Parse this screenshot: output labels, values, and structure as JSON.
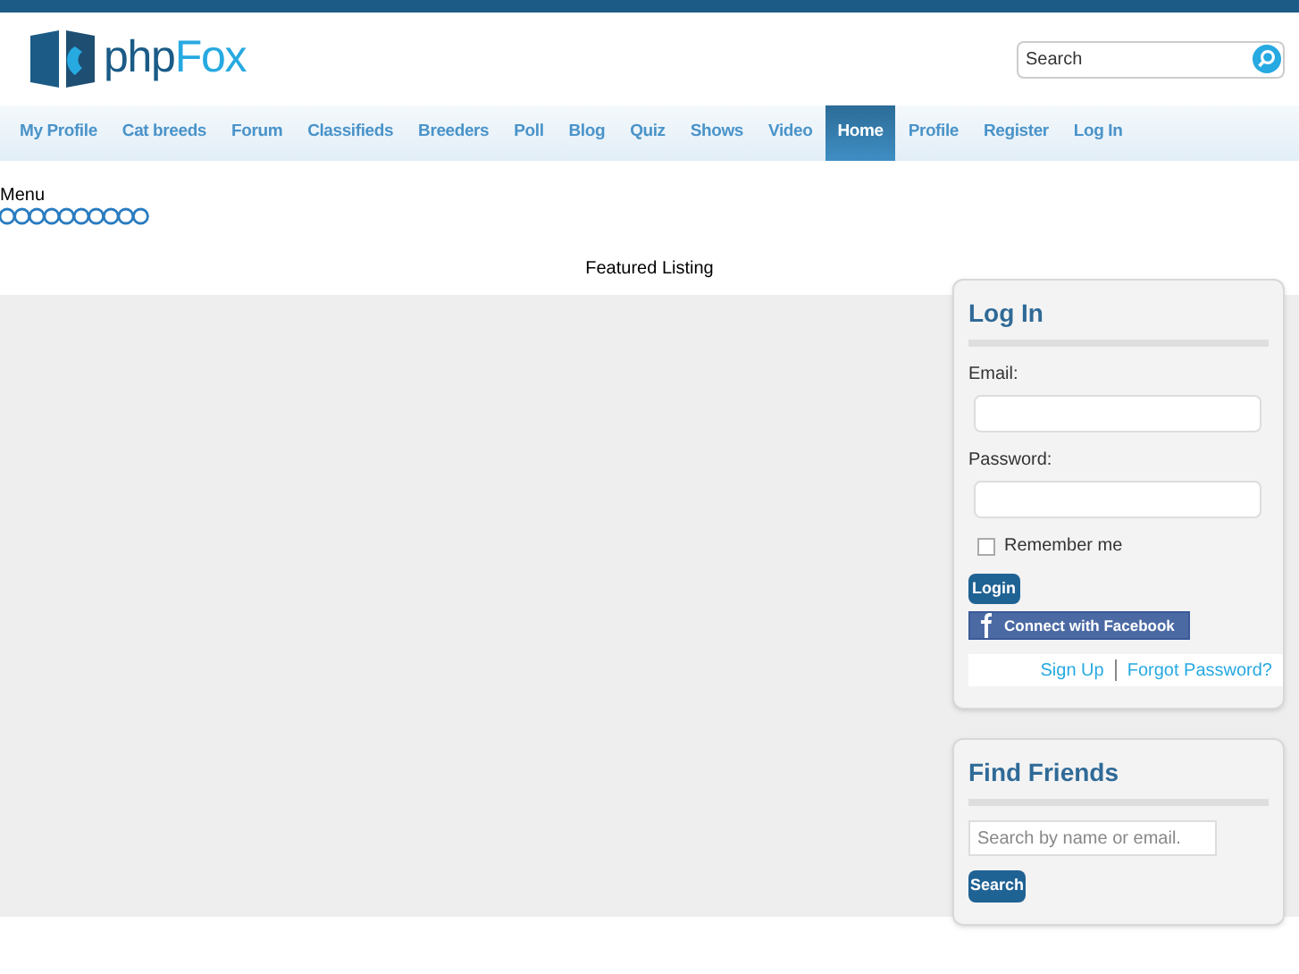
{
  "header": {
    "logo": {
      "first": "php",
      "second": "Fox"
    },
    "search": {
      "placeholder": "Search"
    }
  },
  "nav": [
    {
      "label": "My Profile",
      "selected": false
    },
    {
      "label": "Cat breeds",
      "selected": false
    },
    {
      "label": "Forum",
      "selected": false
    },
    {
      "label": "Classifieds",
      "selected": false
    },
    {
      "label": "Breeders",
      "selected": false
    },
    {
      "label": "Poll",
      "selected": false
    },
    {
      "label": "Blog",
      "selected": false
    },
    {
      "label": "Quiz",
      "selected": false
    },
    {
      "label": "Shows",
      "selected": false
    },
    {
      "label": "Video",
      "selected": false
    },
    {
      "label": "Home",
      "selected": true
    },
    {
      "label": "Profile",
      "selected": false
    },
    {
      "label": "Register",
      "selected": false
    },
    {
      "label": "Log In",
      "selected": false
    }
  ],
  "menu": {
    "label": "Menu"
  },
  "featured": {
    "title": "Featured Listing"
  },
  "login": {
    "title": "Log In",
    "email_label": "Email:",
    "password_label": "Password:",
    "remember": {
      "label": "Remember me",
      "checked": false
    },
    "submit": "Login",
    "facebook": "Connect with Facebook",
    "links": [
      "Sign Up",
      "Forgot Password?"
    ]
  },
  "find_friends": {
    "title": "Find Friends",
    "placeholder": "Search by name or email.",
    "button": "Search"
  }
}
